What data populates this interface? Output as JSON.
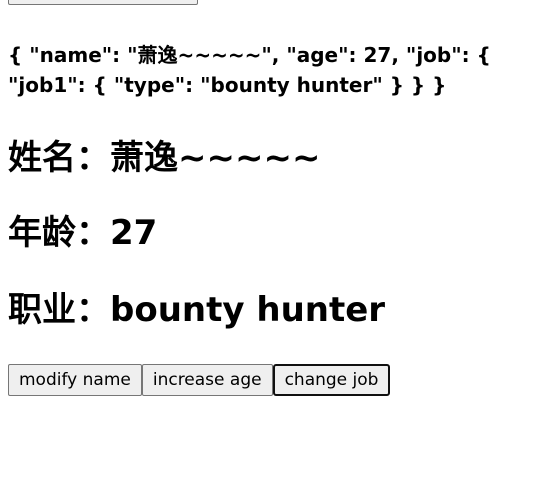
{
  "json_text": "{ \"name\": \"萧逸~~~~~\", \"age\": 27, \"job\": { \"job1\": { \"type\": \"bounty hunter\" } } }",
  "person": {
    "name_label": "姓名：",
    "name_value": "萧逸~~~~~",
    "age_label": "年龄：",
    "age_value": "27",
    "job_label": "职业：",
    "job_value": "bounty hunter"
  },
  "buttons": {
    "top_partial_label": "",
    "modify_name": "modify name",
    "increase_age": "increase age",
    "change_job": "change job"
  }
}
